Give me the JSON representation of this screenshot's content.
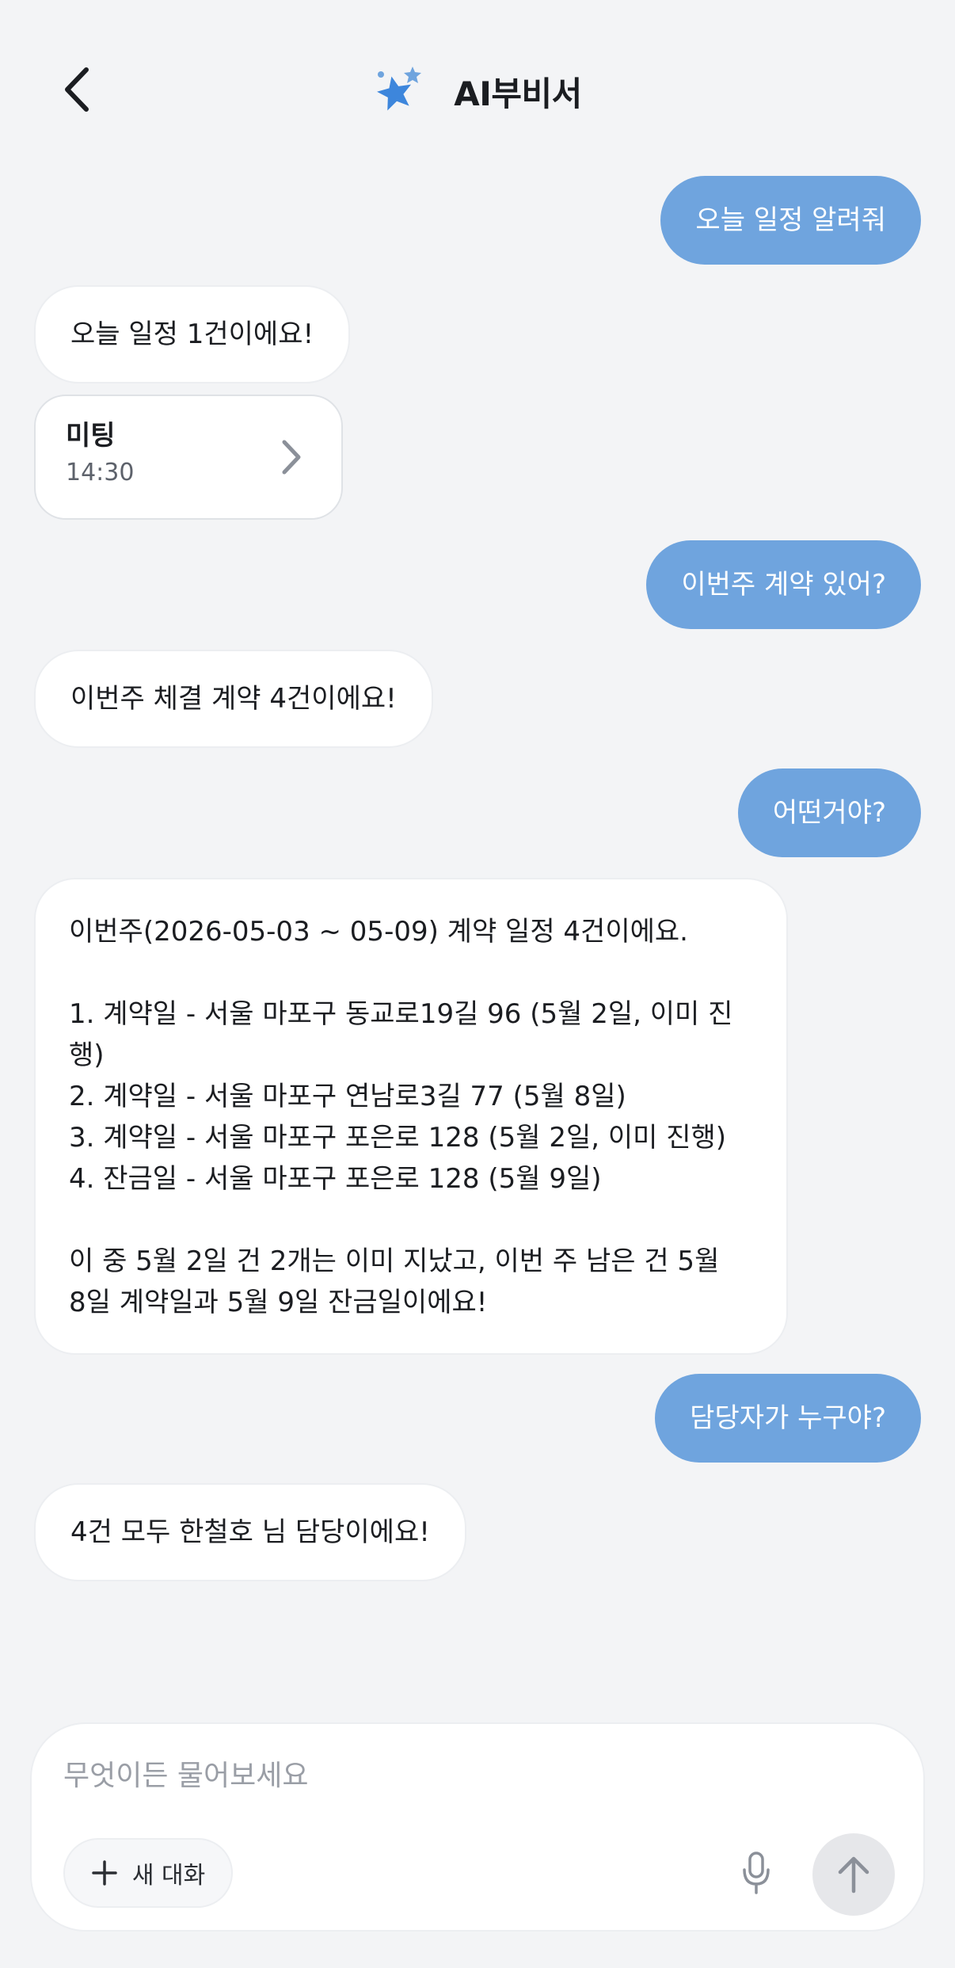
{
  "header": {
    "title": "AI부비서",
    "icons": {
      "back": "chevron-left-icon",
      "logo": "sparkle-stars-icon"
    },
    "colors": {
      "logo_large": "#3d86dc",
      "logo_small": "#6fa4de"
    }
  },
  "messages": [
    {
      "role": "user",
      "text": "오늘 일정 알려줘"
    },
    {
      "role": "bot",
      "text": "오늘 일정 1건이에요!"
    },
    {
      "role": "card",
      "title": "미팅",
      "time": "14:30"
    },
    {
      "role": "user",
      "text": "이번주 계약 있어?"
    },
    {
      "role": "bot",
      "text": "이번주 체결 계약 4건이에요!"
    },
    {
      "role": "user",
      "text": "어떤거야?"
    },
    {
      "role": "bot",
      "lines": [
        "이번주(2026-05-03 ~ 05-09) 계약 일정 4건이에요.",
        "",
        "1. 계약일 - 서울 마포구 동교로19길 96 (5월 2일, 이미 진",
        "행)",
        "2. 계약일 - 서울 마포구 연남로3길 77 (5월 8일)",
        "3. 계약일 - 서울 마포구 포은로 128 (5월 2일, 이미 진행)",
        "4. 잔금일 - 서울 마포구 포은로 128 (5월 9일)",
        "",
        "이 중 5월 2일 건 2개는 이미 지났고, 이번 주 남은 건 5월",
        "8일 계약일과 5월 9일 잔금일이에요!"
      ]
    },
    {
      "role": "user",
      "text": "담당자가 누구야?"
    },
    {
      "role": "bot",
      "text": "4건 모두 한철호 님 담당이에요!"
    }
  ],
  "composer": {
    "value": "",
    "placeholder": "무엇이든 물어보세요",
    "new_chat_label": "새 대화",
    "icons": {
      "new_chat": "plus-icon",
      "mic": "microphone-icon",
      "send": "arrow-up-icon"
    }
  },
  "colors": {
    "background": "#f3f4f6",
    "user_bubble": "#6fa4de",
    "bot_bubble": "#ffffff",
    "text": "#1b1d21",
    "send_button": "#e6e7ea"
  }
}
